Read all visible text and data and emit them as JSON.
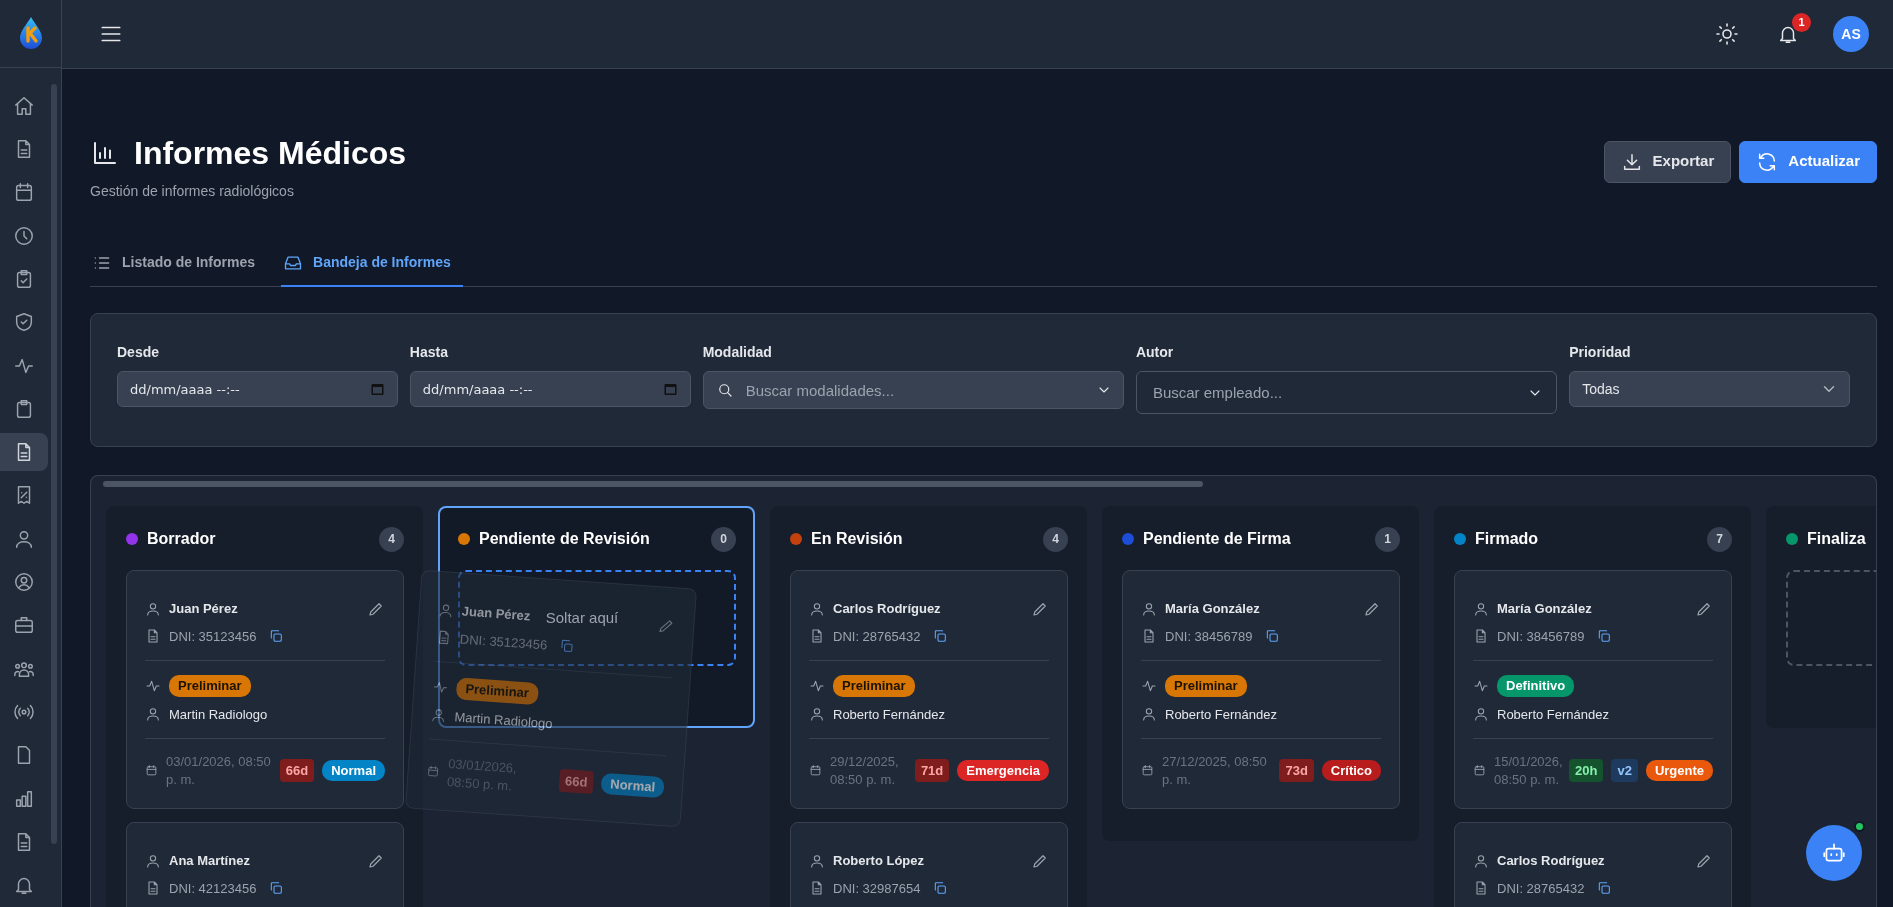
{
  "sidebar": {
    "items": [
      {
        "selected": false
      },
      {
        "selected": false
      },
      {
        "selected": false
      },
      {
        "selected": false
      },
      {
        "selected": false
      },
      {
        "selected": false
      },
      {
        "selected": false
      },
      {
        "selected": false
      },
      {
        "selected": true
      },
      {
        "selected": false
      },
      {
        "selected": false
      },
      {
        "selected": false
      },
      {
        "selected": false
      },
      {
        "selected": false
      },
      {
        "selected": false
      },
      {
        "selected": false
      },
      {
        "selected": false
      },
      {
        "selected": false
      },
      {
        "selected": false
      }
    ]
  },
  "header": {
    "notification_count": "1",
    "avatar_initials": "AS"
  },
  "page": {
    "title": "Informes Médicos",
    "subtitle": "Gestión de informes radiológicos",
    "buttons": [
      {
        "label": "Exportar",
        "kind": "secondary"
      },
      {
        "label": "Actualizar",
        "kind": "primary"
      }
    ]
  },
  "tabs": [
    {
      "label": "Listado de Informes",
      "selected": false
    },
    {
      "label": "Bandeja de Informes",
      "selected": true
    }
  ],
  "filters": [
    {
      "label": "Desde",
      "kind": "datetime",
      "placeholder": "dd/mm/aaaa --:--"
    },
    {
      "label": "Hasta",
      "kind": "datetime",
      "placeholder": "dd/mm/aaaa --:--"
    },
    {
      "label": "Modalidad",
      "kind": "search",
      "placeholder": "Buscar modalidades..."
    },
    {
      "label": "Autor",
      "kind": "combo",
      "placeholder": "Buscar empleado..."
    },
    {
      "label": "Prioridad",
      "kind": "select",
      "value": "Todas"
    }
  ],
  "kanban": {
    "columns": [
      {
        "title": "Borrador",
        "color": "#9333ea",
        "count": "4",
        "drop_target": false,
        "drop_zone": false,
        "cards": [
          {
            "patient": "Juan Pérez",
            "dni": "DNI: 35123456",
            "status": {
              "label": "Preliminar",
              "kind": "preliminar"
            },
            "author": "Martin Radiologo",
            "date": "03/01/2026, 08:50 p. m.",
            "age": {
              "label": "66d",
              "kind": "overdue"
            },
            "priority": {
              "label": "Normal",
              "kind": "normal"
            }
          },
          {
            "patient": "Ana Martínez",
            "dni": "DNI: 42123456"
          }
        ]
      },
      {
        "title": "Pendiente de Revisión",
        "color": "#d97706",
        "count": "0",
        "drop_target": true,
        "drop_zone": true,
        "drop_zone_label": "Soltar aquí"
      },
      {
        "title": "En Revisión",
        "color": "#c2410c",
        "count": "4",
        "drop_target": false,
        "drop_zone": false,
        "cards": [
          {
            "patient": "Carlos Rodríguez",
            "dni": "DNI: 28765432",
            "status": {
              "label": "Preliminar",
              "kind": "preliminar"
            },
            "author": "Roberto Fernández",
            "date": "29/12/2025, 08:50 p. m.",
            "age": {
              "label": "71d",
              "kind": "overdue"
            },
            "priority": {
              "label": "Emergencia",
              "kind": "emergencia"
            }
          },
          {
            "patient": "Roberto López",
            "dni": "DNI: 32987654"
          }
        ]
      },
      {
        "title": "Pendiente de Firma",
        "color": "#1d4ed8",
        "count": "1",
        "drop_target": false,
        "drop_zone": false,
        "cards": [
          {
            "patient": "María González",
            "dni": "DNI: 38456789",
            "status": {
              "label": "Preliminar",
              "kind": "preliminar"
            },
            "author": "Roberto Fernández",
            "date": "27/12/2025, 08:50 p. m.",
            "age": {
              "label": "73d",
              "kind": "overdue"
            },
            "priority": {
              "label": "Crítico",
              "kind": "critico"
            }
          }
        ]
      },
      {
        "title": "Firmado",
        "color": "#0284c7",
        "count": "7",
        "drop_target": false,
        "drop_zone": false,
        "cards": [
          {
            "patient": "María González",
            "dni": "DNI: 38456789",
            "status": {
              "label": "Definitivo",
              "kind": "definitivo"
            },
            "author": "Roberto Fernández",
            "date": "15/01/2026, 08:50 p. m.",
            "age": {
              "label": "20h",
              "kind": "recent"
            },
            "version": "v2",
            "priority": {
              "label": "Urgente",
              "kind": "urgente"
            }
          },
          {
            "patient": "Carlos Rodríguez",
            "dni": "DNI: 28765432"
          }
        ]
      },
      {
        "title": "Finaliza",
        "color": "#059669",
        "drop_target": false,
        "drop_zone": true
      }
    ],
    "dragging_card": {
      "patient": "Juan Pérez",
      "dni": "DNI: 35123456",
      "status": {
        "label": "Preliminar",
        "kind": "preliminar"
      },
      "author": "Martin Radiologo",
      "date": "03/01/2026, 08:50 p. m.",
      "age": {
        "label": "66d",
        "kind": "overdue"
      },
      "priority": {
        "label": "Normal",
        "kind": "normal"
      }
    }
  }
}
